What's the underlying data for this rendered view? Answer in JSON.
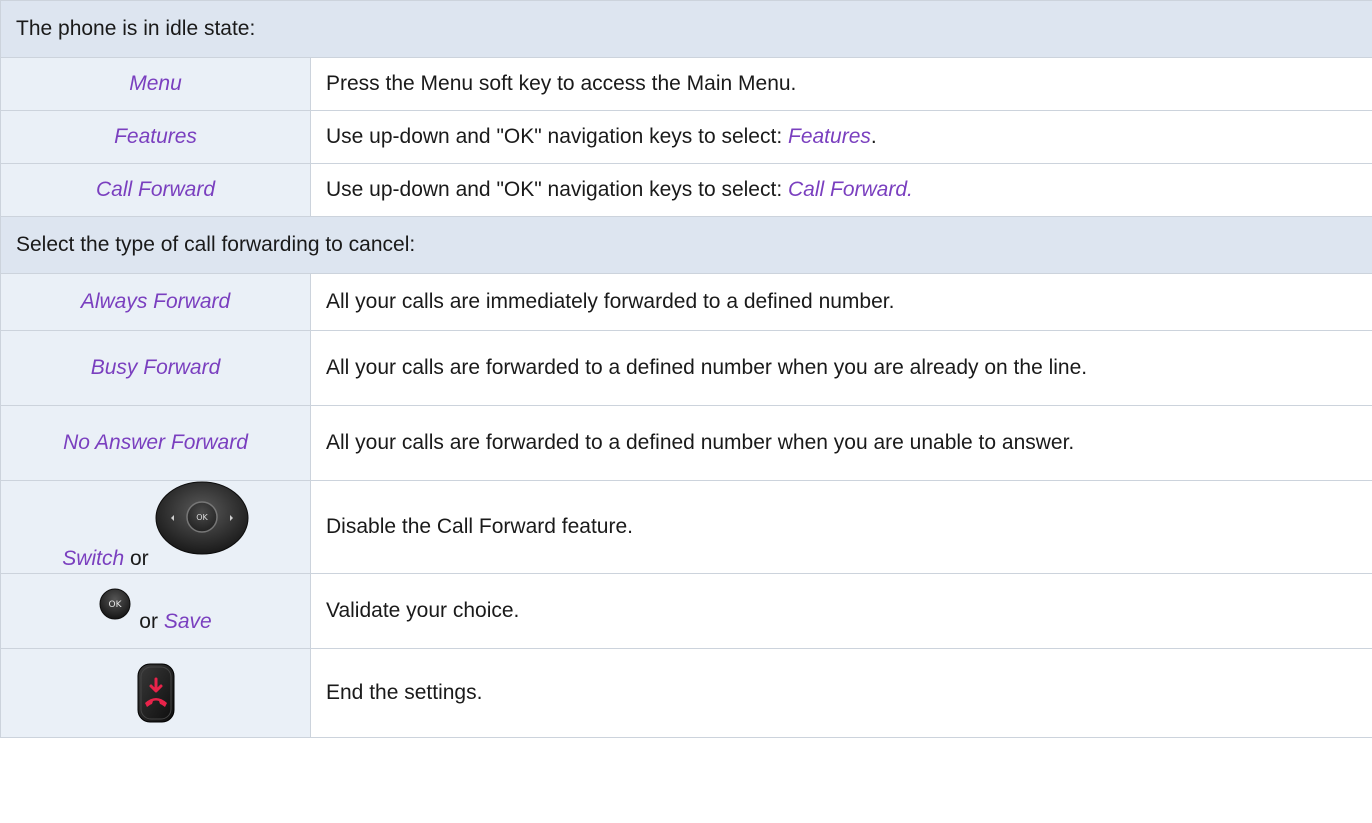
{
  "sections": {
    "idle": "The phone is in idle state:",
    "select_type": "Select the type of call forwarding to cancel:"
  },
  "rows": {
    "menu": {
      "key": "Menu",
      "desc": "Press the Menu soft key to access the Main Menu."
    },
    "features": {
      "key": "Features",
      "desc_prefix": "Use up-down and \"OK\" navigation keys to select: ",
      "desc_em": "Features",
      "desc_suffix": "."
    },
    "call_forward": {
      "key": "Call Forward",
      "desc_prefix": "Use up-down and \"OK\" navigation keys to select: ",
      "desc_em": "Call Forward."
    },
    "always": {
      "key": "Always Forward",
      "desc": "All your calls are immediately forwarded to a defined number."
    },
    "busy": {
      "key": "Busy Forward",
      "desc": "All your calls are forwarded to a defined number when you are already on the line."
    },
    "no_answer": {
      "key": "No Answer Forward",
      "desc": "All your calls are forwarded to a defined number when you are unable to answer."
    },
    "switch": {
      "key": "Switch",
      "or": "or",
      "icon_text": "OK",
      "desc": "Disable the Call Forward feature."
    },
    "save": {
      "icon_text": "OK",
      "or": "or",
      "key": "Save",
      "desc": "Validate your choice."
    },
    "end": {
      "desc": "End the settings."
    }
  },
  "icons": {
    "navigator": "navigator-ok-icon",
    "ok": "ok-key-icon",
    "hangup": "hangup-key-icon"
  },
  "colors": {
    "accent": "#7a3fbf",
    "section_bg": "#dde5f0",
    "key_bg": "#eaf0f7",
    "hangup_red": "#e8234a"
  }
}
